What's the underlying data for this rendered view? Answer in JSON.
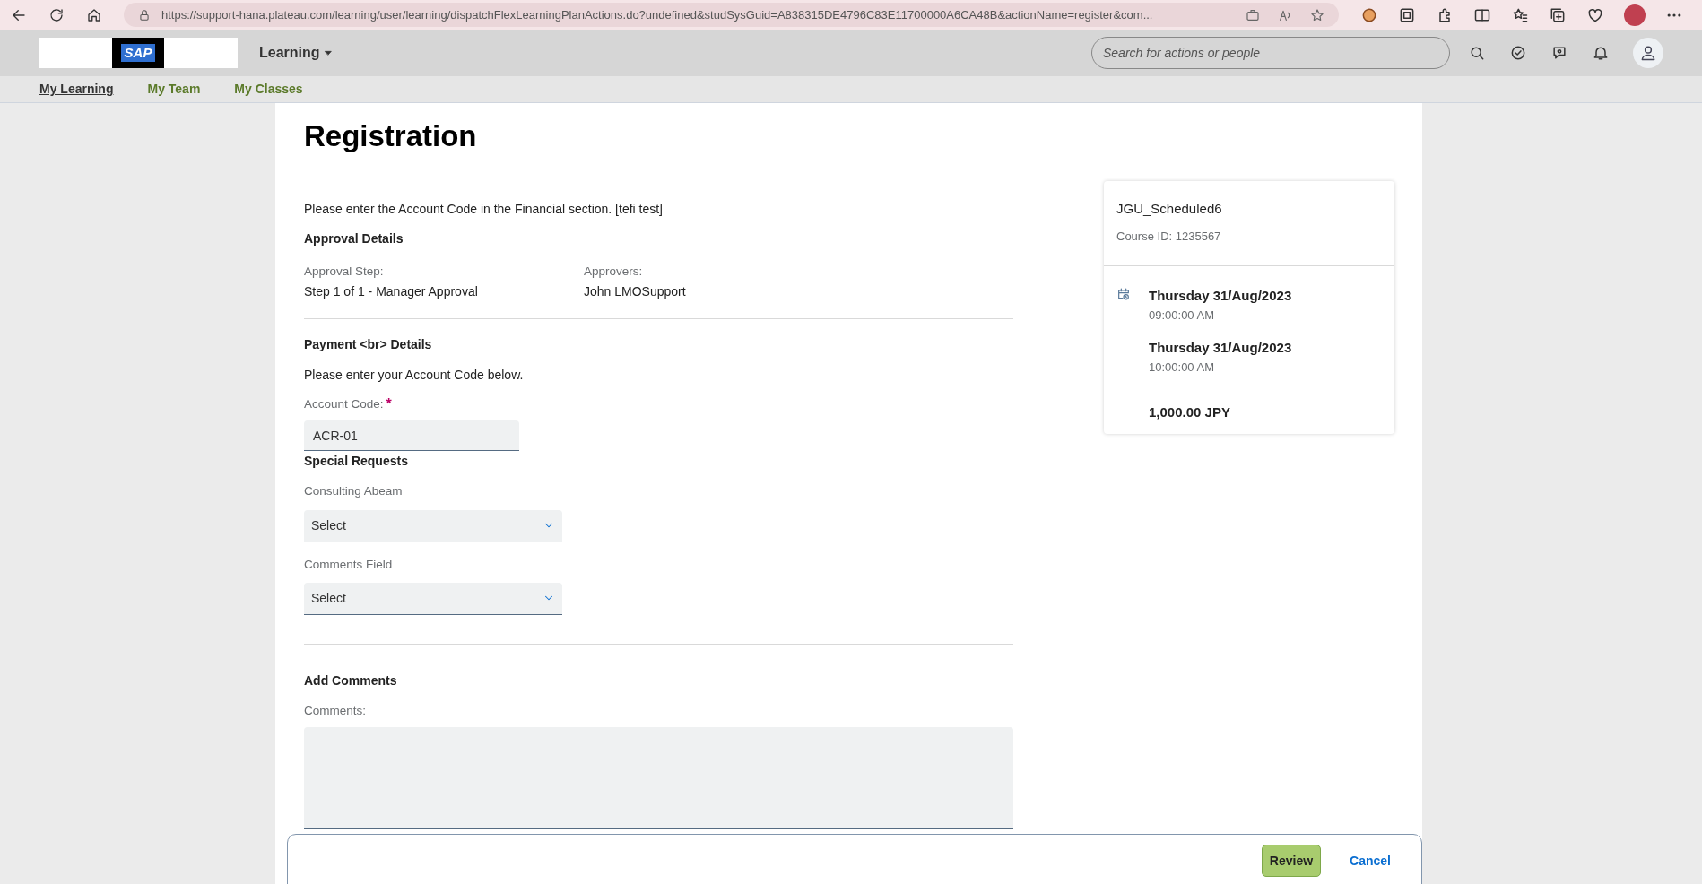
{
  "browser": {
    "url": "https://support-hana.plateau.com/learning/user/learning/dispatchFlexLearningPlanActions.do?undefined&studSysGuid=A838315DE4796C83E11700000A6CA48B&actionName=register&com..."
  },
  "header": {
    "logo_text": "SAP",
    "app_menu": "Learning",
    "search_placeholder": "Search for actions or people"
  },
  "nav_tabs": [
    {
      "label": "My Learning",
      "selected": true
    },
    {
      "label": "My Team",
      "selected": false
    },
    {
      "label": "My Classes",
      "selected": false
    }
  ],
  "title": "Registration",
  "message": "Please enter the Account Code in the Financial section. [tefi test]",
  "approval": {
    "title": "Approval Details",
    "fields": [
      {
        "label": "Approval Step:",
        "value": "Step 1 of 1 - Manager Approval"
      },
      {
        "label": "Approvers:",
        "value": "John LMOSupport"
      }
    ]
  },
  "payment": {
    "title": "Payment <br> Details",
    "instruction": "Please enter your Account Code below.",
    "field": {
      "label": "Account Code:",
      "required_mark": "*",
      "value": "ACR-01"
    }
  },
  "special_requests": {
    "title": "Special Requests",
    "dropdowns": [
      {
        "label": "Consulting Abeam",
        "value": "Select"
      },
      {
        "label": "Comments Field",
        "value": "Select"
      }
    ]
  },
  "comments": {
    "title": "Add Comments",
    "label": "Comments:"
  },
  "course": {
    "title": "JGU_Scheduled6",
    "course_id": "Course ID: 1235567",
    "sessions": [
      {
        "date": "Thursday 31/Aug/2023",
        "time": "09:00:00 AM"
      },
      {
        "date": "Thursday 31/Aug/2023",
        "time": "10:00:00 AM"
      }
    ],
    "price": "1,000.00 JPY"
  },
  "actions": [
    {
      "label": "Review",
      "kind": "primary"
    },
    {
      "label": "Cancel",
      "kind": "link"
    }
  ]
}
